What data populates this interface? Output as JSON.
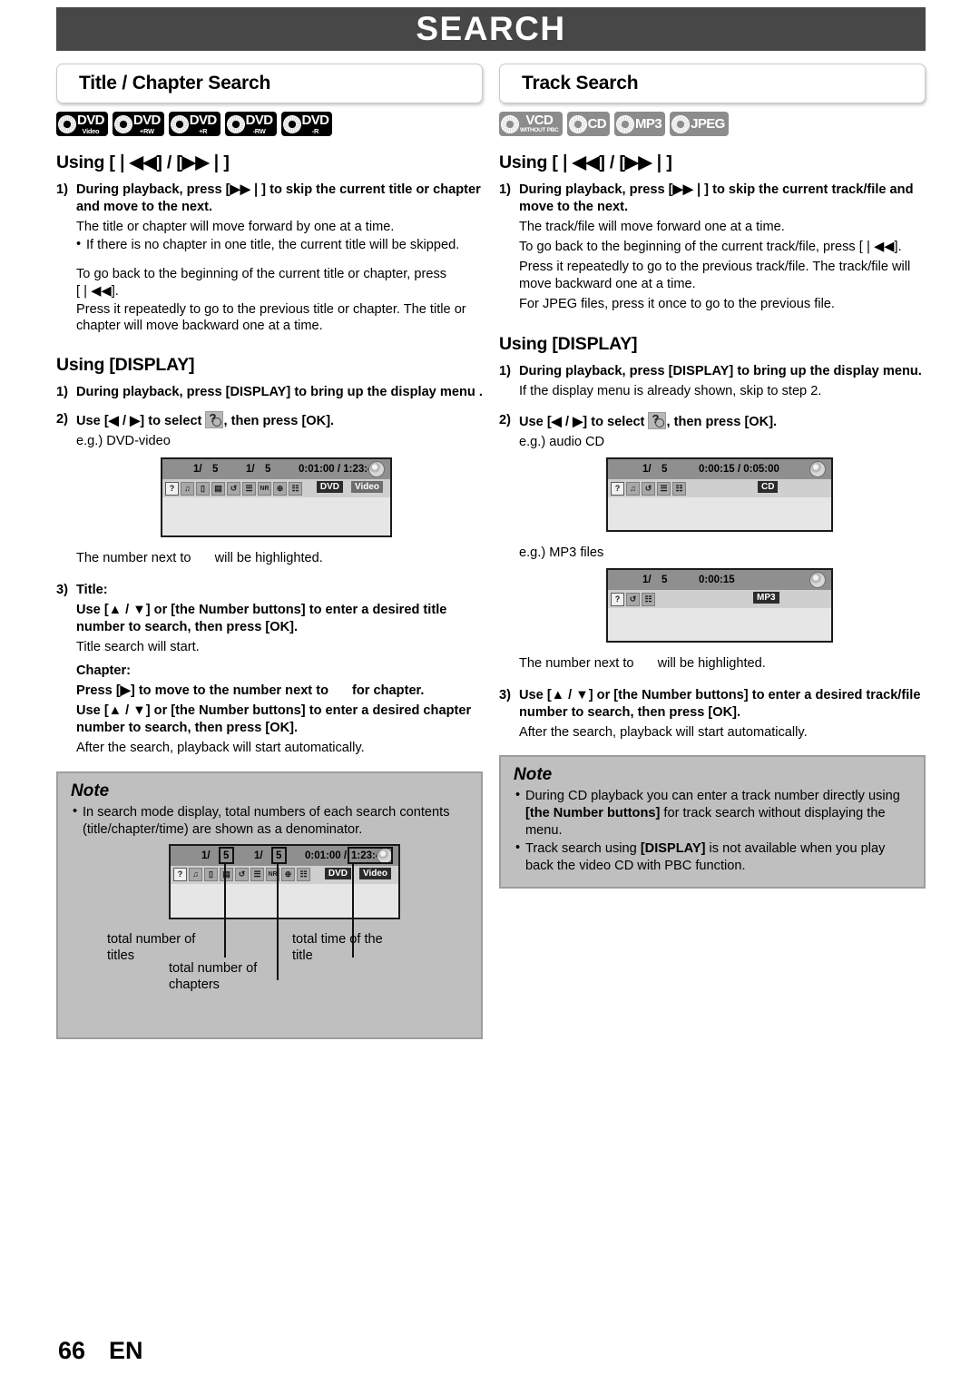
{
  "page": {
    "banner_title": "SEARCH",
    "footer_page": "66",
    "footer_lang": "EN"
  },
  "left": {
    "section_title": "Title / Chapter Search",
    "badges": [
      {
        "main": "DVD",
        "sub": "Video",
        "style": "black"
      },
      {
        "main": "DVD",
        "sub": "+RW",
        "style": "black"
      },
      {
        "main": "DVD",
        "sub": "+R",
        "style": "black"
      },
      {
        "main": "DVD",
        "sub": "-RW",
        "style": "black"
      },
      {
        "main": "DVD",
        "sub": "-R",
        "style": "black"
      }
    ],
    "using_skip_heading": "Using [❘◀◀] / [▶▶❘]",
    "step1_num": "1)",
    "step1_bold": "During playback, press [▶▶❘] to skip the current title or chapter and move to the next.",
    "step1_p1": "The title or chapter will move forward by one at a time.",
    "step1_bullet1": "If there is no chapter in one title, the current title will be skipped.",
    "step1_p2": "To go back to the beginning of the current title or chapter, press [❘◀◀].",
    "step1_p3": "Press it repeatedly to go to the previous title or chapter. The title or chapter will move backward one at a time.",
    "using_display_heading": "Using [DISPLAY]",
    "d_step1_num": "1)",
    "d_step1_bold": "During playback, press [DISPLAY] to bring up the display menu .",
    "d_step2_num": "2)",
    "d_step2_a": "Use [◀ / ▶] to select",
    "d_step2_b": ", then press [OK].",
    "d_eg": "e.g.) DVD-video",
    "osd_dvd": {
      "title_idx": "1/",
      "title_total": "5",
      "chapter_idx": "1/",
      "chapter_total": "5",
      "time": "0:01:00 / 1:23:45",
      "icons": [
        "search",
        "audio",
        "subtitle",
        "angle",
        "repeat",
        "marker",
        "NR",
        "zoom",
        "surround"
      ],
      "tag1": "DVD",
      "tag2": "Video"
    },
    "highlight_a": "The number next to",
    "highlight_b": "will be highlighted.",
    "step3_num": "3)",
    "step3_title_label": "Title:",
    "step3_title_bold": "Use [▲ / ▼] or [the Number buttons] to enter a desired title number to search, then press [OK].",
    "step3_title_p": "Title search will start.",
    "step3_chapter_label": "Chapter:",
    "step3_chapter_bold_a": "Press [▶] to move to the number next to",
    "step3_chapter_bold_b": "for chapter.",
    "step3_chapter_bold2": "Use [▲ / ▼] or [the Number buttons] to enter a desired chapter number to search, then press [OK].",
    "step3_chapter_p": "After the search, playback will start automatically.",
    "note": {
      "heading": "Note",
      "items": [
        "In search mode display, total numbers of each search contents (title/chapter/time) are shown as a denominator."
      ],
      "osd": {
        "title_idx": "1/",
        "title_total": "5",
        "chapter_idx": "1/",
        "chapter_total": "5",
        "time_a": "0:01:00 /",
        "time_b": "1:23:45",
        "tag1": "DVD",
        "tag2": "Video"
      },
      "callouts": [
        "total number of titles",
        "total number of chapters",
        "total time of the title"
      ]
    }
  },
  "right": {
    "section_title": "Track Search",
    "badges": [
      {
        "main": "VCD",
        "sub": "WITHOUT PBC",
        "style": "gray"
      },
      {
        "main": "CD",
        "sub": "",
        "style": "gray"
      },
      {
        "main": "MP3",
        "sub": "",
        "style": "gray"
      },
      {
        "main": "JPEG",
        "sub": "",
        "style": "gray"
      }
    ],
    "using_skip_heading": "Using [❘◀◀] / [▶▶❘]",
    "step1_num": "1)",
    "step1_bold": "During playback, press [▶▶❘] to skip the current track/file and move to the next.",
    "step1_p1": "The track/file will move forward one at a time.",
    "step1_p2": "To go back to the beginning of the current track/file, press [❘◀◀].",
    "step1_p3": "Press it repeatedly to go to the previous track/file. The track/file will move backward one at a time.",
    "step1_p4": "For JPEG files, press it once to go to the previous file.",
    "using_display_heading": "Using [DISPLAY]",
    "d_step1_num": "1)",
    "d_step1_bold": "During playback, press [DISPLAY] to bring up the display menu.",
    "d_step1_p": "If the display menu is already shown, skip to step 2.",
    "d_step2_num": "2)",
    "d_step2_a": "Use [◀ / ▶] to select",
    "d_step2_b": ", then press [OK].",
    "eg_cd": "e.g.) audio CD",
    "osd_cd": {
      "track_idx": "1/",
      "track_total": "5",
      "time": "0:00:15 / 0:05:00",
      "tag": "CD"
    },
    "eg_mp3": "e.g.) MP3 files",
    "osd_mp3": {
      "track_idx": "1/",
      "track_total": "5",
      "time": "0:00:15",
      "tag": "MP3"
    },
    "highlight_a": "The number next to",
    "highlight_b": "will be highlighted.",
    "step3_num": "3)",
    "step3_bold": "Use [▲ / ▼] or [the Number buttons] to enter a desired track/file number to search, then press [OK].",
    "step3_p": "After the search, playback will start automatically.",
    "note": {
      "heading": "Note",
      "item1_a": "During CD playback you can enter a track number directly using ",
      "item1_b": "[the Number buttons]",
      "item1_c": " for track search without displaying the menu.",
      "item2_a": "Track search using ",
      "item2_b": "[DISPLAY]",
      "item2_c": " is not available when you play back the video CD with PBC function."
    }
  }
}
